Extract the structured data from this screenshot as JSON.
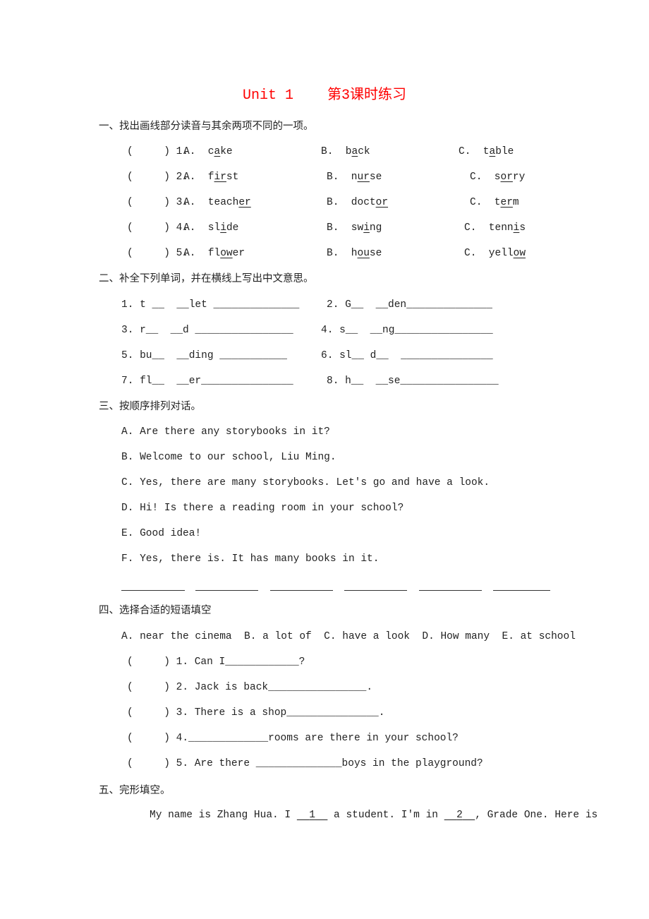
{
  "title": "Unit 1    第3课时练习",
  "sections": {
    "s1": {
      "heading": "一、找出画线部分读音与其余两项不同的一项。",
      "items": [
        {
          "num": "(     ) 1.",
          "a": [
            "A.  c",
            "a",
            "ke"
          ],
          "b": [
            "B.  b",
            "a",
            "ck"
          ],
          "c": [
            "C.  t",
            "a",
            "ble"
          ]
        },
        {
          "num": "(     ) 2.",
          "a": [
            "A.  f",
            "ir",
            "st"
          ],
          "b": [
            "B.  n",
            "ur",
            "se"
          ],
          "c": [
            "C.  s",
            "or",
            "ry"
          ]
        },
        {
          "num": "(     ) 3.",
          "a": [
            "A.  teach",
            "er",
            ""
          ],
          "b": [
            "B.  doct",
            "or",
            ""
          ],
          "c": [
            "C.  t",
            "er",
            "m"
          ]
        },
        {
          "num": "(     ) 4.",
          "a": [
            "A.  sl",
            "i",
            "de"
          ],
          "b": [
            "B.  sw",
            "i",
            "ng"
          ],
          "c": [
            "C.  tenn",
            "i",
            "s"
          ]
        },
        {
          "num": "(     ) 5.",
          "a": [
            "A.  fl",
            "ow",
            "er"
          ],
          "b": [
            "B.  h",
            "ou",
            "se"
          ],
          "c": [
            "C.  yell",
            "ow",
            ""
          ]
        }
      ]
    },
    "s2": {
      "heading": "二、补全下列单词，并在横线上写出中文意思。",
      "items": [
        {
          "left": "1. t __  __let ______________",
          "right": "2. G__  __den______________"
        },
        {
          "left": "3. r__  __d ________________",
          "right": "4. s__  __ng________________"
        },
        {
          "left": "5. bu__  __ding ___________",
          "right": "6. sl__ d__  _______________"
        },
        {
          "left": "7. fl__  __er_______________",
          "right": "8. h__  __se________________"
        }
      ]
    },
    "s3": {
      "heading": "三、按顺序排列对话。",
      "items": [
        "A. Are there any storybooks in it?",
        "B. Welcome to our school, Liu Ming.",
        "C. Yes, there are many storybooks. Let's go and have a look.",
        "D. Hi! Is there a reading room in your school?",
        "E. Good idea!",
        "F. Yes, there is. It has many books in it."
      ]
    },
    "s4": {
      "heading": "四、选择合适的短语填空",
      "options": "A. near the cinema  B. a lot of  C. have a look  D. How many  E. at school",
      "items": [
        "(     ) 1. Can I____________?",
        "(     ) 2. Jack is back________________.",
        "(     ) 3. There is a shop_______________.",
        "(     ) 4._____________rooms are there in your school?",
        "(     ) 5. Are there ______________boys in the playground?"
      ]
    },
    "s5": {
      "heading": "五、完形填空。",
      "text_before_1": "My name is Zhang Hua. I ",
      "blank1": "1",
      "text_between": " a student. I'm in ",
      "blank2": "2",
      "text_after": ", Grade One. Here is"
    }
  }
}
